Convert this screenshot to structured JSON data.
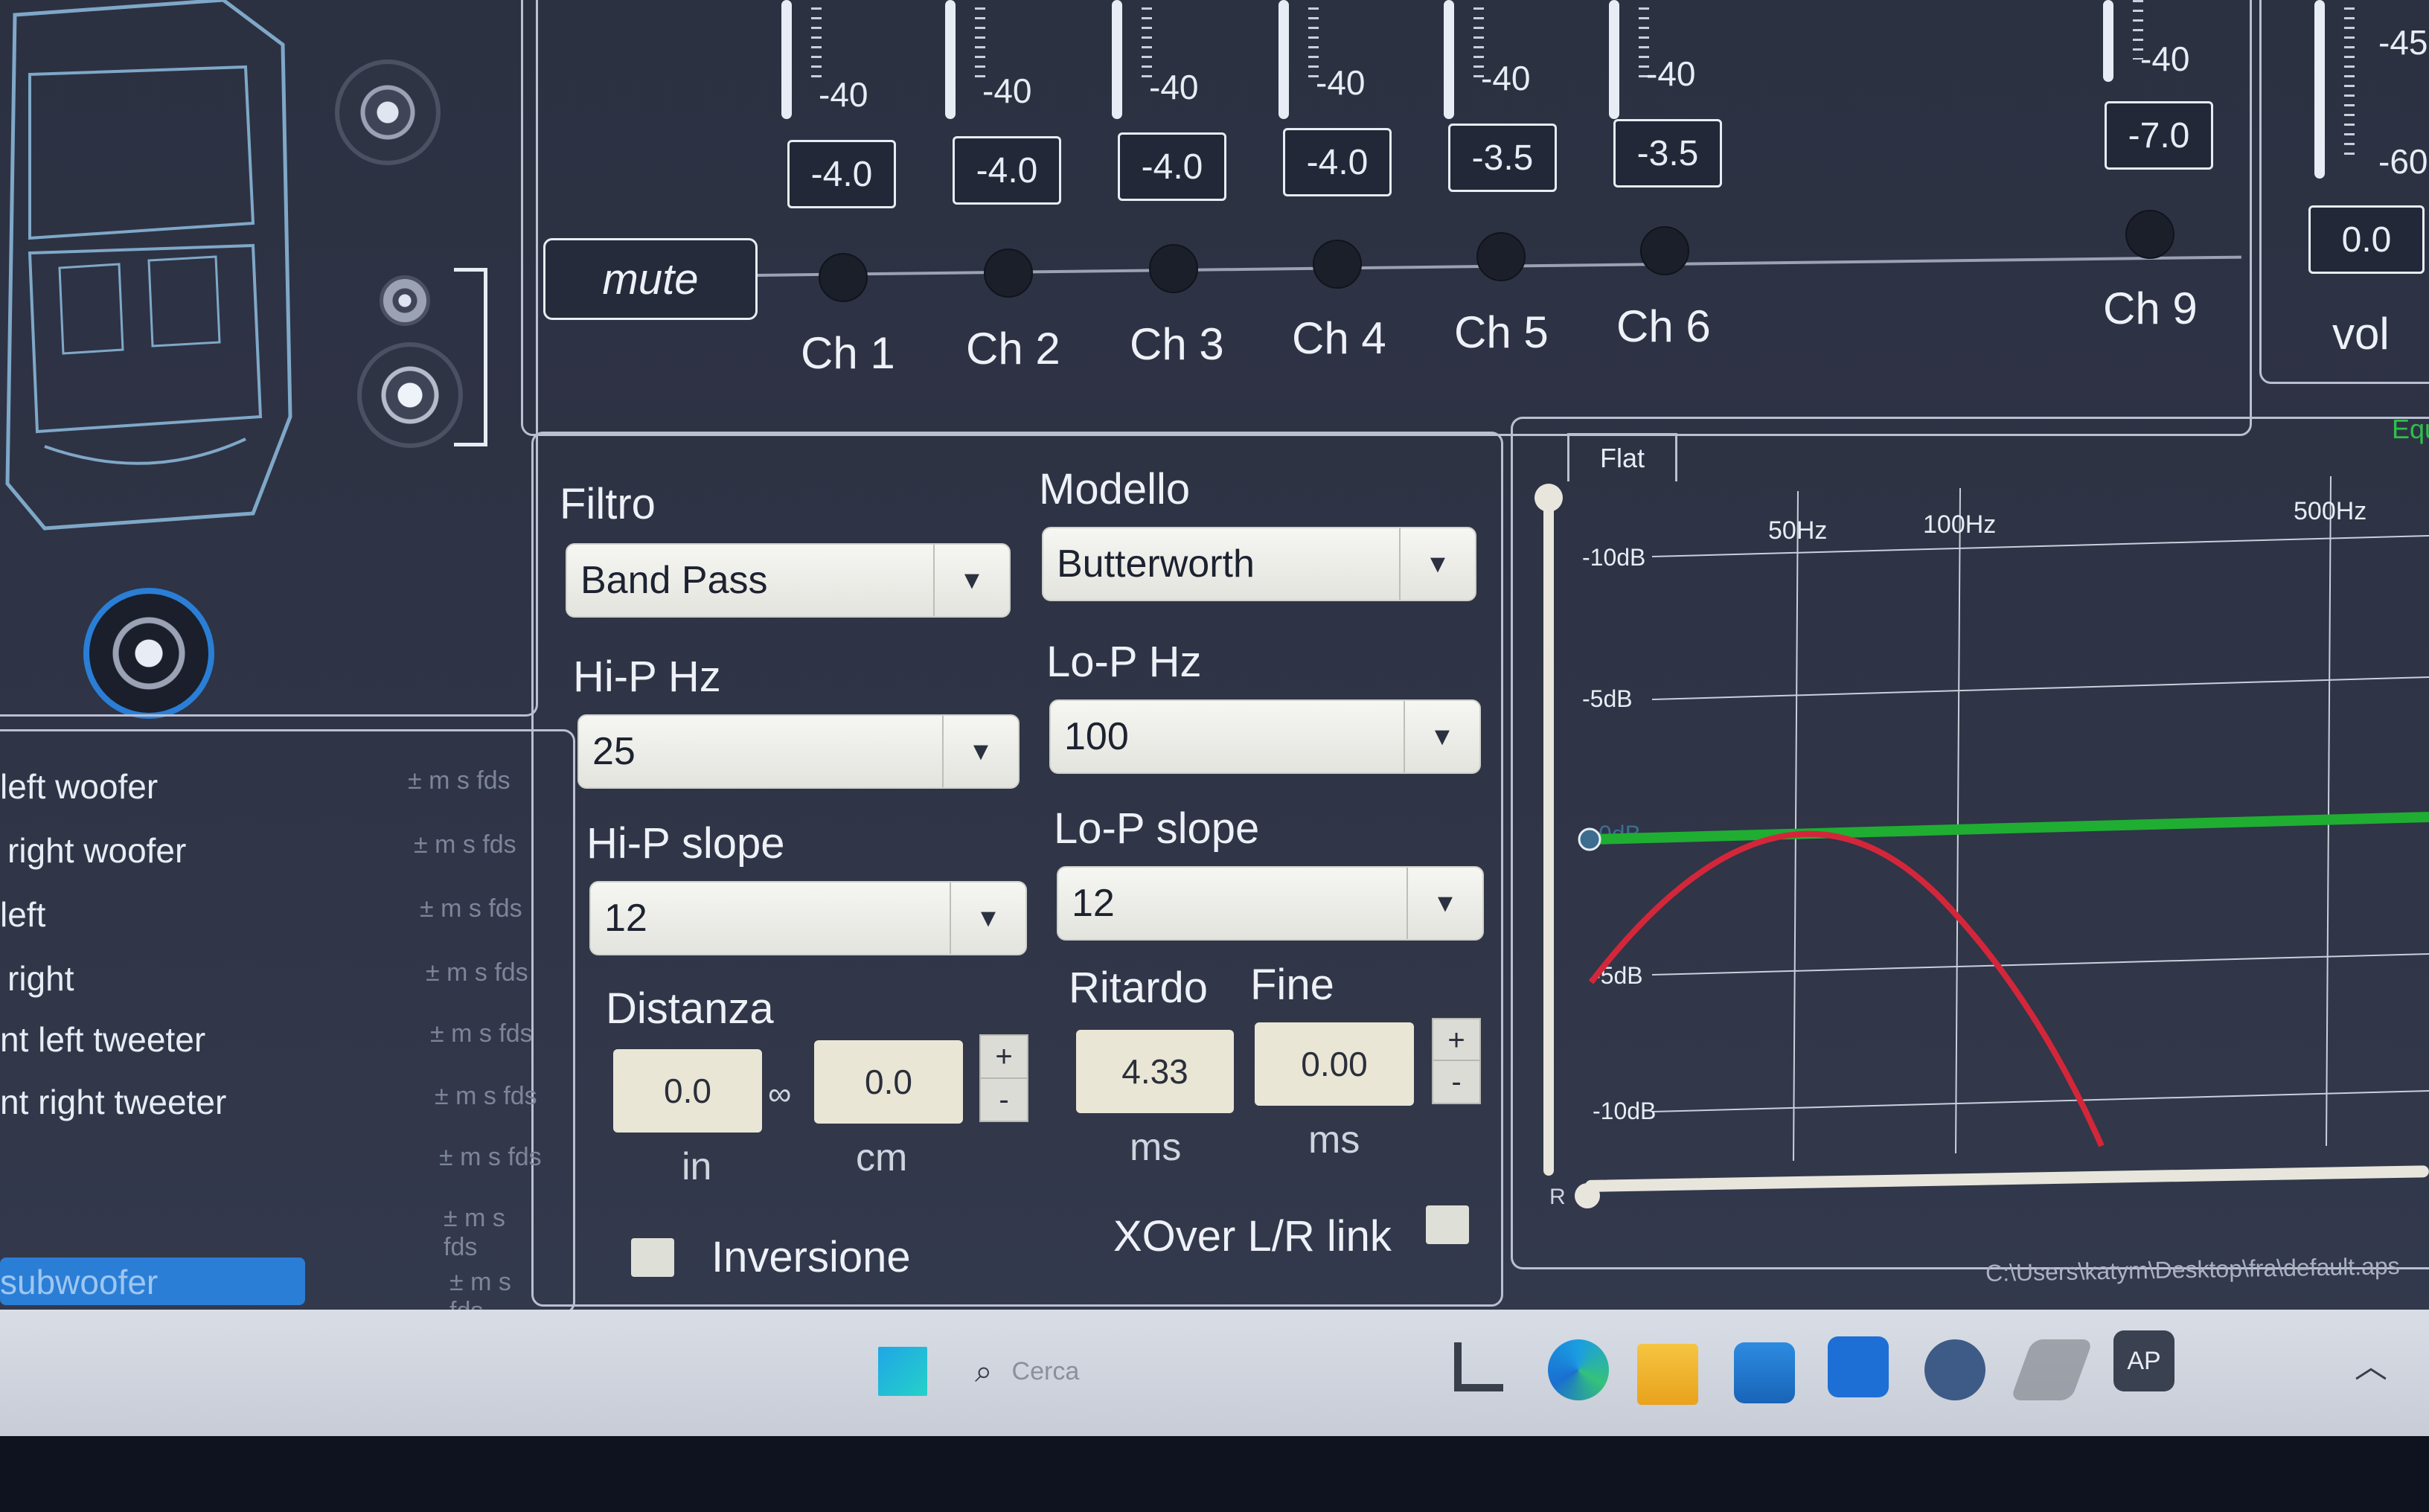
{
  "mixer": {
    "mute_label": "mute",
    "channels": [
      {
        "label": "Ch 1",
        "db_floor": "-40",
        "value": "-4.0"
      },
      {
        "label": "Ch 2",
        "db_floor": "-40",
        "value": "-4.0"
      },
      {
        "label": "Ch 3",
        "db_floor": "-40",
        "value": "-4.0"
      },
      {
        "label": "Ch 4",
        "db_floor": "-40",
        "value": "-4.0"
      },
      {
        "label": "Ch 5",
        "db_floor": "-40",
        "value": "-3.5"
      },
      {
        "label": "Ch 6",
        "db_floor": "-40",
        "value": "-3.5"
      },
      {
        "label": "Ch 9",
        "db_floor": "-40",
        "value": "-7.0"
      }
    ],
    "vol": {
      "label": "vol",
      "value": "0.0",
      "scale_top": "-45",
      "scale_bottom": "-60"
    }
  },
  "filter": {
    "filtro_label": "Filtro",
    "filtro_value": "Band Pass",
    "modello_label": "Modello",
    "modello_value": "Butterworth",
    "hip_hz_label": "Hi-P Hz",
    "hip_hz_value": "25",
    "lop_hz_label": "Lo-P Hz",
    "lop_hz_value": "100",
    "hip_slope_label": "Hi-P slope",
    "hip_slope_value": "12",
    "lop_slope_label": "Lo-P slope",
    "lop_slope_value": "12",
    "distanza_label": "Distanza",
    "distanza_in": "0.0",
    "distanza_cm": "0.0",
    "unit_in": "in",
    "unit_cm": "cm",
    "ritardo_label": "Ritardo",
    "fine_label": "Fine",
    "ritardo_value": "4.33",
    "fine_value": "0.00",
    "unit_ms": "ms",
    "plus": "+",
    "minus": "-",
    "inversione_label": "Inversione",
    "xover_label": "XOver L/R link"
  },
  "graph": {
    "flat_button": "Flat",
    "freq_labels": [
      "50Hz",
      "100Hz",
      "500Hz"
    ],
    "db_labels": [
      "-10dB",
      "-5dB",
      "0dB",
      "-5dB",
      "-10dB"
    ],
    "r_label": "R",
    "corner_label": "Equ"
  },
  "speaker_list": [
    {
      "name": "left woofer",
      "meta": "± m s fds"
    },
    {
      "name": "right woofer",
      "meta": "± m s fds"
    },
    {
      "name": "left",
      "meta": "± m s fds"
    },
    {
      "name": "right",
      "meta": "± m s fds"
    },
    {
      "name": "nt left tweeter",
      "meta": "± m s fds"
    },
    {
      "name": "nt right tweeter",
      "meta": "± m s fds"
    },
    {
      "name": "",
      "meta": "± m s fds"
    },
    {
      "name": "",
      "meta": "± m s fds"
    },
    {
      "name": "subwoofer",
      "meta": "± m s fds"
    }
  ],
  "status_path": "C:\\Users\\katym\\Desktop\\fra\\default.aps",
  "taskbar": {
    "search_placeholder": "Cerca",
    "app_badge": "AP"
  },
  "colors": {
    "eq_flat_line": "#1fae32",
    "eq_curve": "#d4263a",
    "accent_blue": "#2a7ed6"
  }
}
